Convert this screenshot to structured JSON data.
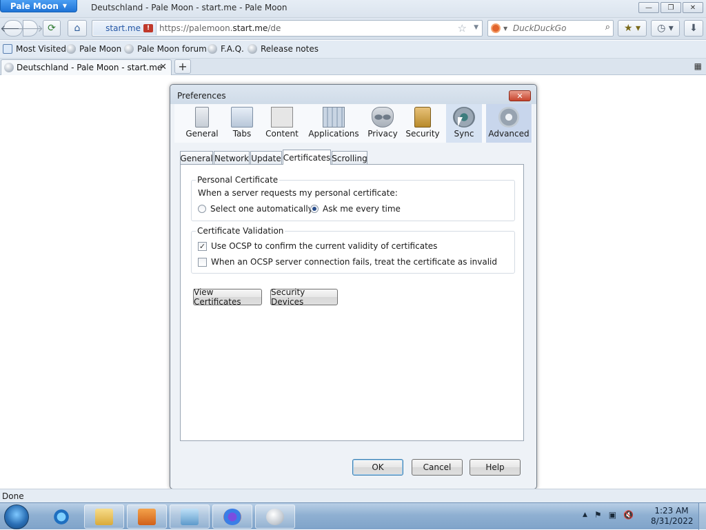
{
  "window": {
    "app_button": "Pale Moon",
    "title": "Deutschland - Pale Moon - start.me - Pale Moon",
    "controls": {
      "minimize": "▭",
      "maximize": "❐",
      "close": "✕"
    }
  },
  "navbar": {
    "identity": "start.me",
    "url_prefix": "https://palemoon.",
    "url_domain": "start.me",
    "url_suffix": "/de",
    "search_placeholder": "DuckDuckGo"
  },
  "bookmarks": [
    "Most Visited",
    "Pale Moon",
    "Pale Moon forum",
    "F.A.Q.",
    "Release notes"
  ],
  "tab": {
    "label": "Deutschland - Pale Moon - start.me",
    "close": "✕",
    "new": "+"
  },
  "dialog": {
    "title": "Preferences",
    "panes": [
      {
        "label": "General",
        "icon": "general-pane-icon"
      },
      {
        "label": "Tabs",
        "icon": "tabs-pane-icon"
      },
      {
        "label": "Content",
        "icon": "content-pane-icon"
      },
      {
        "label": "Applications",
        "icon": "applications-pane-icon"
      },
      {
        "label": "Privacy",
        "icon": "privacy-mask-icon"
      },
      {
        "label": "Security",
        "icon": "padlock-icon"
      },
      {
        "label": "Sync",
        "icon": "sync-icon"
      },
      {
        "label": "Advanced",
        "icon": "gear-icon"
      }
    ],
    "selected_pane": "Advanced",
    "subtabs": [
      "General",
      "Network",
      "Update",
      "Certificates",
      "Scrolling"
    ],
    "selected_subtab": "Certificates",
    "personal": {
      "legend": "Personal Certificate",
      "prompt": "When a server requests my personal certificate:",
      "option_auto": "Select one automatically",
      "option_ask": "Ask me every time",
      "selected": "Ask me every time"
    },
    "validation": {
      "legend": "Certificate Validation",
      "ocsp": {
        "label": "Use OCSP to confirm the current validity of certificates",
        "checked": true
      },
      "fail_invalid": {
        "label": "When an OCSP server connection fails, treat the certificate as invalid",
        "checked": false
      }
    },
    "view_certificates": "View Certificates",
    "security_devices": "Security Devices",
    "ok": "OK",
    "cancel": "Cancel",
    "help": "Help"
  },
  "status": "Done",
  "taskbar": {
    "time": "1:23 AM",
    "date": "8/31/2022",
    "tray_up": "▲"
  }
}
